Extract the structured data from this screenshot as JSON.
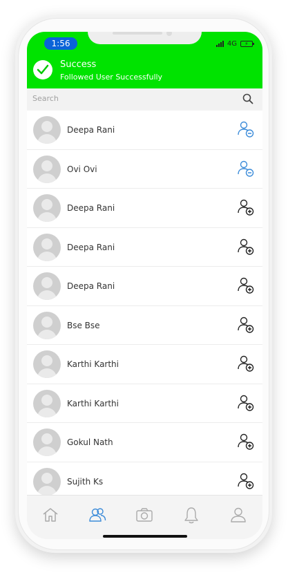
{
  "status_bar": {
    "time": "1:56",
    "network": "4G"
  },
  "toast": {
    "title": "Success",
    "message": "Followed User Successfully",
    "color": "#00e300"
  },
  "search": {
    "placeholder": "Search"
  },
  "users": [
    {
      "name": "Deepa Rani",
      "following": true
    },
    {
      "name": "Ovi Ovi",
      "following": true
    },
    {
      "name": "Deepa Rani",
      "following": false
    },
    {
      "name": "Deepa Rani",
      "following": false
    },
    {
      "name": "Deepa Rani",
      "following": false
    },
    {
      "name": "Bse Bse",
      "following": false
    },
    {
      "name": "Karthi Karthi",
      "following": false
    },
    {
      "name": "Karthi Karthi",
      "following": false
    },
    {
      "name": "Gokul Nath",
      "following": false
    },
    {
      "name": "Sujith Ks",
      "following": false
    }
  ],
  "icons": {
    "following": "remove-user-icon",
    "not_following": "add-user-icon"
  },
  "colors": {
    "accent": "#3b8bd9",
    "time_pill": "#0a63d8"
  },
  "bottom_nav": {
    "active": "users-nav",
    "items": [
      {
        "name": "home-icon"
      },
      {
        "name": "users-icon"
      },
      {
        "name": "camera-icon"
      },
      {
        "name": "bell-icon"
      },
      {
        "name": "profile-icon"
      }
    ]
  }
}
